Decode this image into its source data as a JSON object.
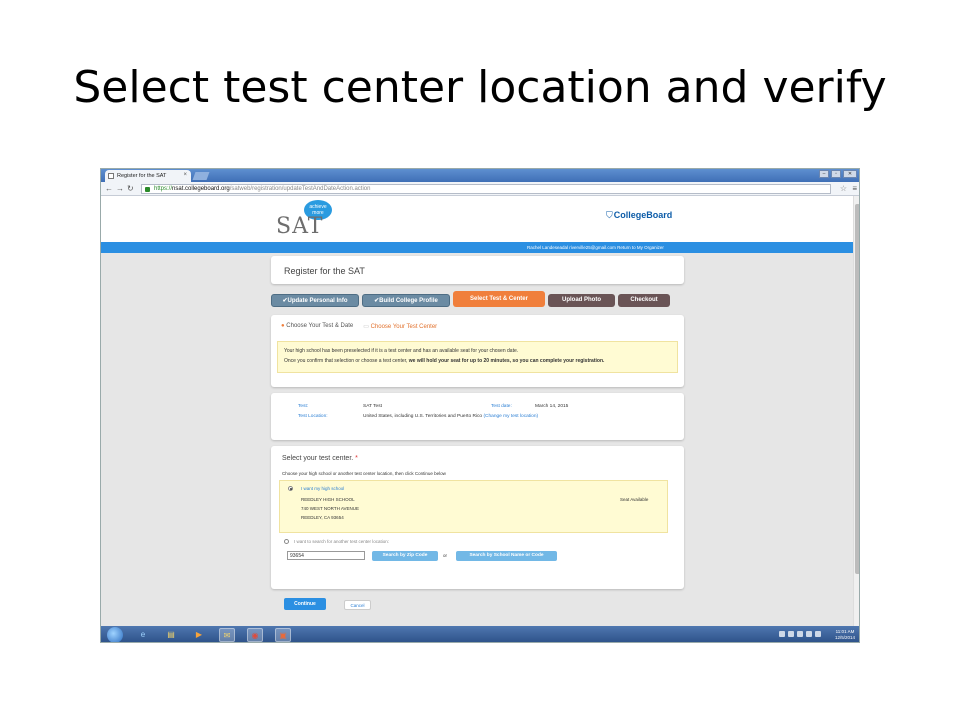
{
  "slide_title": "Select test center location and verify",
  "browser": {
    "tab_title": "Register for the SAT",
    "tab_close": "×",
    "url_https": "https://",
    "url_host": "nsat.collegeboard.org",
    "url_path": "/satweb/registration/updateTestAndDateAction.action"
  },
  "header": {
    "sat_logo": "SAT",
    "badge_line1": "achieve",
    "badge_line2": "more",
    "collegeboard": "CollegeBoard",
    "user_info": "Rachel Landeseadal   riverville25@gmail.com   Return to My Organizer"
  },
  "register": {
    "title": "Register for the SAT"
  },
  "steps": [
    {
      "label": "✔Update Personal Info",
      "state": "done"
    },
    {
      "label": "✔Build College Profile",
      "state": "done"
    },
    {
      "label": "Select Test & Center",
      "state": "active"
    },
    {
      "label": "Upload Photo",
      "state": "todo"
    },
    {
      "label": "Checkout",
      "state": "todo"
    }
  ],
  "substeps": {
    "first": "Choose Your Test & Date",
    "second": "Choose Your Test Center"
  },
  "notice": {
    "line1": "Your high school has been preselected if it is a test center and has an available seat for your chosen date.",
    "line2_prefix": "Once you confirm that selection or choose a test center,",
    "line2_bold": "we will hold your seat for up to 20 minutes, so you can complete your registration."
  },
  "test_info": {
    "test_label": "Test:",
    "test_value": "SAT Test",
    "date_label": "Test date:",
    "date_value": "March 14, 2015",
    "location_label": "Test Location:",
    "location_value": "United States, including U.S. Territories and Puerto Rico",
    "location_link": "(Change my test location)"
  },
  "select_center": {
    "title": "Select your test center.",
    "required": "*",
    "instructions": "Choose your high school or another test center location, then click Continue below",
    "option_hs": "I want my high school",
    "school_name": "REEDLEY HIGH SCHOOL",
    "school_street": "740 WEST NORTH AVENUE",
    "school_city": "REEDLEY, CA 93654",
    "seat_status": "Seat Available",
    "option_search": "I want to search for another test center location:",
    "zip_value": "93654",
    "search_zip": "Search by Zip Code",
    "or": "or",
    "search_name": "Search by School Name or Code"
  },
  "actions": {
    "continue": "Continue",
    "cancel": "Cancel"
  },
  "taskbar": {
    "time": "11:01 AM",
    "date": "12/5/2014"
  }
}
